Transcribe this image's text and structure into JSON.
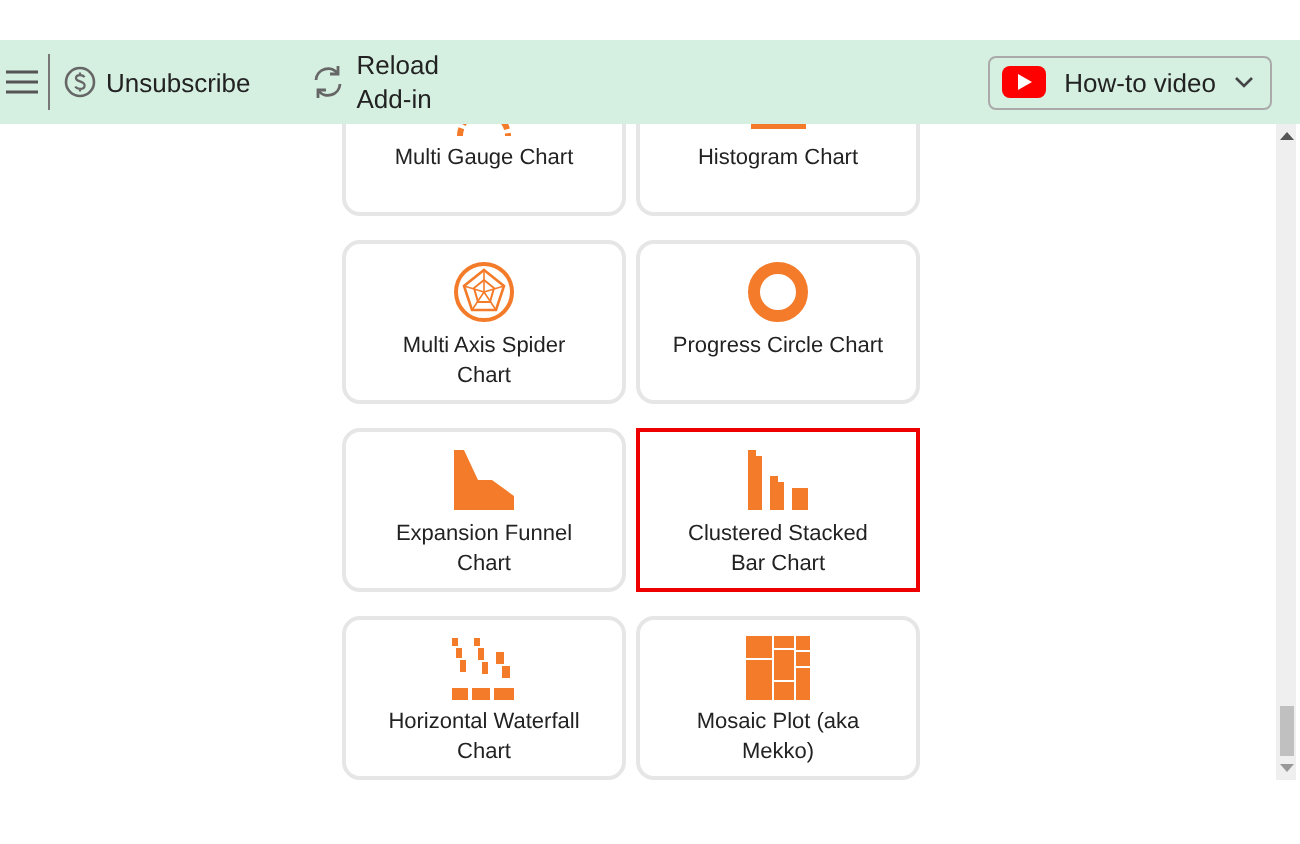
{
  "toolbar": {
    "unsubscribe": "Unsubscribe",
    "reload": [
      "Reload",
      "Add-in"
    ],
    "video_button": "How-to video"
  },
  "cards": [
    {
      "kind": "gauge",
      "label": "Multi Gauge Chart",
      "selected": false
    },
    {
      "kind": "histogram",
      "label": "Histogram Chart",
      "selected": false
    },
    {
      "kind": "spider",
      "label": "Multi Axis Spider Chart",
      "selected": false
    },
    {
      "kind": "ring",
      "label": "Progress Circle Chart",
      "selected": false
    },
    {
      "kind": "funnel",
      "label": "Expansion Funnel Chart",
      "selected": false
    },
    {
      "kind": "clustered",
      "label": "Clustered Stacked Bar Chart",
      "selected": true
    },
    {
      "kind": "waterfall",
      "label": "Horizontal Waterfall Chart",
      "selected": false
    },
    {
      "kind": "mosaic",
      "label": "Mosaic Plot (aka Mekko)",
      "selected": false
    }
  ]
}
